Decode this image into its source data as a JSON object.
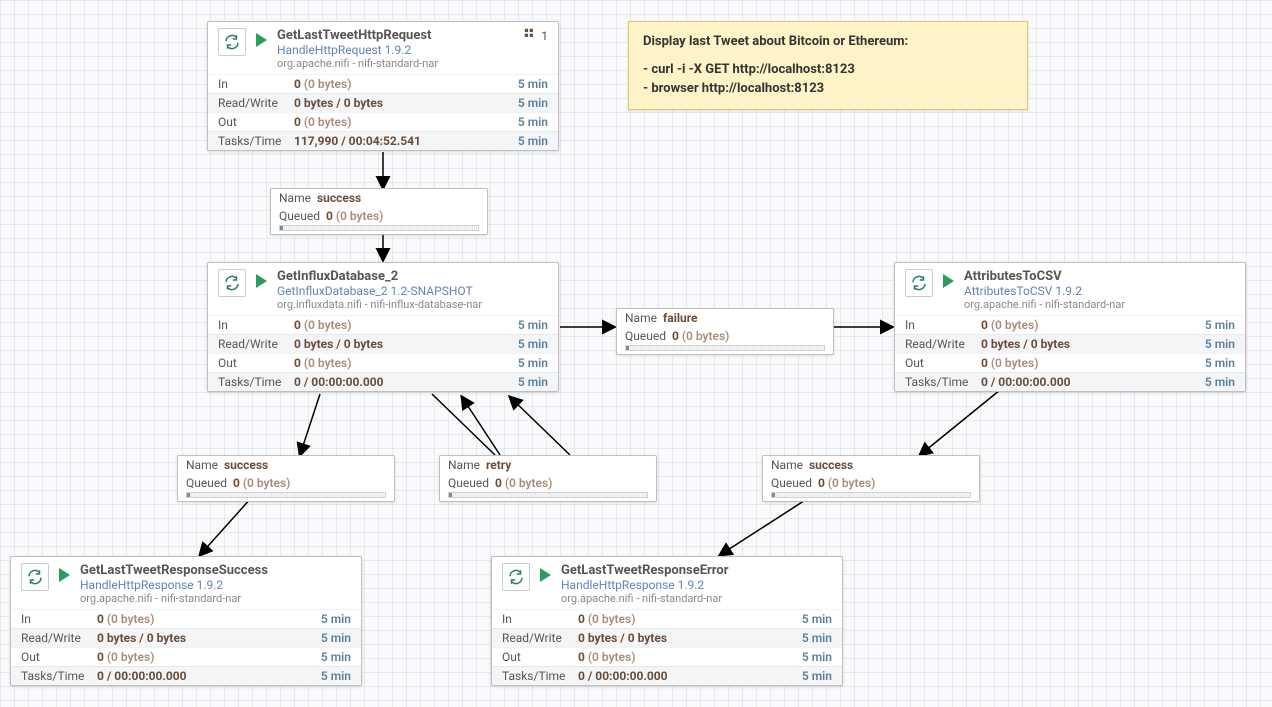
{
  "sticky": {
    "title": "Display last Tweet about Bitcoin or Ethereum:",
    "line1": "- curl -i -X GET http://localhost:8123",
    "line2": "- browser http://localhost:8123"
  },
  "common": {
    "in_label": "In",
    "rw_label": "Read/Write",
    "out_label": "Out",
    "tt_label": "Tasks/Time",
    "window": "5 min",
    "name_label": "Name",
    "queued_label": "Queued"
  },
  "processors": {
    "p1": {
      "name": "GetLastTweetHttpRequest",
      "type": "HandleHttpRequest 1.9.2",
      "bundle": "org.apache.nifi - nifi-standard-nar",
      "threads": "1",
      "in_v": "0",
      "in_d": "(0 bytes)",
      "rw_v": "0 bytes / 0 bytes",
      "out_v": "0",
      "out_d": "(0 bytes)",
      "tt_v": "117,990 / 00:04:52.541"
    },
    "p2": {
      "name": "GetInfluxDatabase_2",
      "type": "GetInfluxDatabase_2 1.2-SNAPSHOT",
      "bundle": "org.influxdata.nifi - nifi-influx-database-nar",
      "in_v": "0",
      "in_d": "(0 bytes)",
      "rw_v": "0 bytes / 0 bytes",
      "out_v": "0",
      "out_d": "(0 bytes)",
      "tt_v": "0 / 00:00:00.000"
    },
    "p3": {
      "name": "AttributesToCSV",
      "type": "AttributesToCSV 1.9.2",
      "bundle": "org.apache.nifi - nifi-standard-nar",
      "in_v": "0",
      "in_d": "(0 bytes)",
      "rw_v": "0 bytes / 0 bytes",
      "out_v": "0",
      "out_d": "(0 bytes)",
      "tt_v": "0 / 00:00:00.000"
    },
    "p4": {
      "name": "GetLastTweetResponseSuccess",
      "type": "HandleHttpResponse 1.9.2",
      "bundle": "org.apache.nifi - nifi-standard-nar",
      "in_v": "0",
      "in_d": "(0 bytes)",
      "rw_v": "0 bytes / 0 bytes",
      "out_v": "0",
      "out_d": "(0 bytes)",
      "tt_v": "0 / 00:00:00.000"
    },
    "p5": {
      "name": "GetLastTweetResponseError",
      "type": "HandleHttpResponse 1.9.2",
      "bundle": "org.apache.nifi - nifi-standard-nar",
      "in_v": "0",
      "in_d": "(0 bytes)",
      "rw_v": "0 bytes / 0 bytes",
      "out_v": "0",
      "out_d": "(0 bytes)",
      "tt_v": "0 / 00:00:00.000"
    }
  },
  "connections": {
    "c1": {
      "name": "success",
      "q_v": "0",
      "q_d": "(0 bytes)"
    },
    "c2": {
      "name": "failure",
      "q_v": "0",
      "q_d": "(0 bytes)"
    },
    "c3": {
      "name": "success",
      "q_v": "0",
      "q_d": "(0 bytes)"
    },
    "c4": {
      "name": "retry",
      "q_v": "0",
      "q_d": "(0 bytes)"
    },
    "c5": {
      "name": "success",
      "q_v": "0",
      "q_d": "(0 bytes)"
    }
  }
}
